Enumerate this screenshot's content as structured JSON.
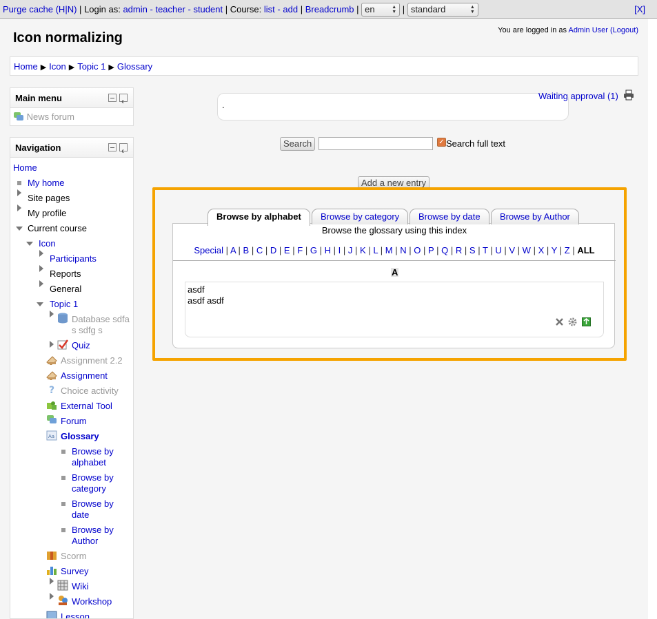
{
  "topbar": {
    "purge_cache": "Purge cache (H|N)",
    "sep1": "|",
    "login_as": "Login as:",
    "admin": "admin",
    "dash1": "-",
    "teacher": "teacher",
    "dash2": "-",
    "student": "student",
    "sep2": "|",
    "course": "Course:",
    "list": "list",
    "dash3": "-",
    "add": "add",
    "sep3": "|",
    "breadcrumb": "Breadcrumb",
    "sep4": "|",
    "lang_value": "en",
    "sep5": "|",
    "theme_value": "standard",
    "close": "[X]"
  },
  "header": {
    "title": "Icon normalizing",
    "login_prefix": "You are logged in as",
    "user": "Admin User",
    "logout": "(Logout)"
  },
  "breadcrumb": [
    "Home",
    "Icon",
    "Topic 1",
    "Glossary"
  ],
  "main_menu": {
    "title": "Main menu",
    "item": "News forum"
  },
  "navigation": {
    "title": "Navigation",
    "items": [
      "Home",
      "My home",
      "Site pages",
      "My profile",
      "Current course",
      "Icon",
      "Participants",
      "Reports",
      "General",
      "Topic 1",
      "Database sdfa",
      "s sdfg s",
      "Quiz",
      "Assignment 2.2",
      "Assignment",
      "Choice activity",
      "External Tool",
      "Forum",
      "Glossary",
      "Browse by",
      "alphabet",
      "Browse by",
      "category",
      "Browse by",
      "date",
      "Browse by",
      "Author",
      "Scorm",
      "Survey",
      "Wiki",
      "Workshop",
      "Lesson"
    ]
  },
  "intro": {
    "text": "."
  },
  "waiting_approval": "Waiting approval (1)",
  "search": {
    "button": "Search",
    "value": "",
    "fulltext_label": "Search full text"
  },
  "add_entry": "Add a new entry",
  "tabs": [
    "Browse by alphabet",
    "Browse by category",
    "Browse by date",
    "Browse by Author"
  ],
  "index_caption": "Browse the glossary using this index",
  "letters": [
    "Special",
    "A",
    "B",
    "C",
    "D",
    "E",
    "F",
    "G",
    "H",
    "I",
    "J",
    "K",
    "L",
    "M",
    "N",
    "O",
    "P",
    "Q",
    "R",
    "S",
    "T",
    "U",
    "V",
    "W",
    "X",
    "Y",
    "Z"
  ],
  "letters_all": "ALL",
  "letter_separator": "|",
  "current_letter": "A",
  "entry": {
    "concept": "asdf",
    "definition": "asdf asdf"
  },
  "colors": {
    "highlight": "#f5a300",
    "link": "#0000cc"
  }
}
